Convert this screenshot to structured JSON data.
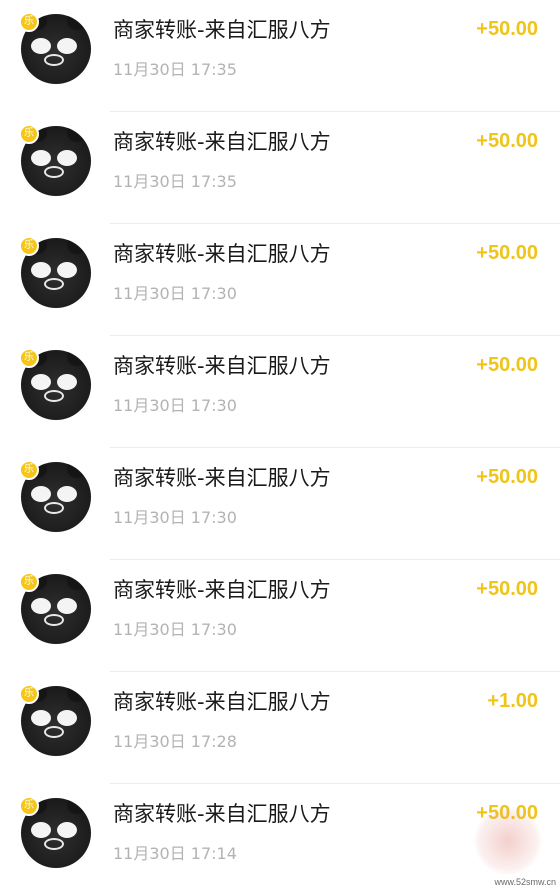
{
  "colors": {
    "amount": "#f0c419",
    "badge": "#f5c518",
    "title": "#1a1a1a",
    "time": "#b3b3b3"
  },
  "avatar_icon": "black-pig-avatar-icon",
  "badge_icon": "pay-badge-icon",
  "badge_text": "乐",
  "transactions": [
    {
      "title": "商家转账-来自汇服八方",
      "time": "11月30日 17:35",
      "amount": "+50.00"
    },
    {
      "title": "商家转账-来自汇服八方",
      "time": "11月30日 17:35",
      "amount": "+50.00"
    },
    {
      "title": "商家转账-来自汇服八方",
      "time": "11月30日 17:30",
      "amount": "+50.00"
    },
    {
      "title": "商家转账-来自汇服八方",
      "time": "11月30日 17:30",
      "amount": "+50.00"
    },
    {
      "title": "商家转账-来自汇服八方",
      "time": "11月30日 17:30",
      "amount": "+50.00"
    },
    {
      "title": "商家转账-来自汇服八方",
      "time": "11月30日 17:30",
      "amount": "+50.00"
    },
    {
      "title": "商家转账-来自汇服八方",
      "time": "11月30日 17:28",
      "amount": "+1.00"
    },
    {
      "title": "商家转账-来自汇服八方",
      "time": "11月30日 17:14",
      "amount": "+50.00"
    }
  ],
  "watermark": "www.52smw.cn"
}
